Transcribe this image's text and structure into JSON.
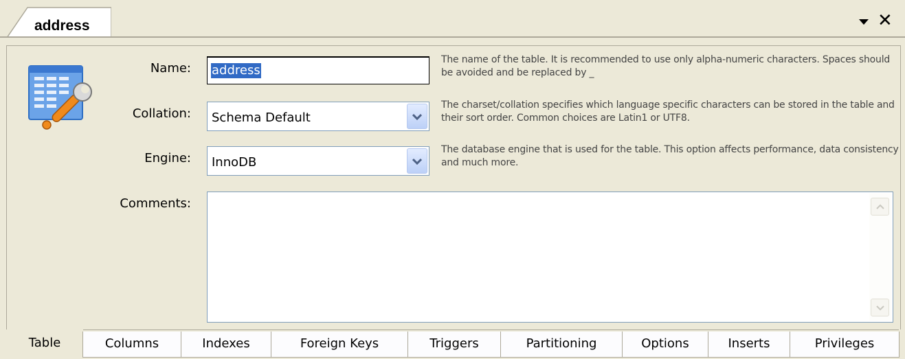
{
  "window": {
    "tab_title": "address",
    "menu_icon": "dropdown-arrow-icon",
    "close_icon": "close-x-icon"
  },
  "form": {
    "name_label": "Name:",
    "name_value": "address",
    "name_help": "The name of the table. It is recommended to use only alpha-numeric characters. Spaces should be avoided and be replaced by _",
    "collation_label": "Collation:",
    "collation_value": "Schema Default",
    "collation_help": "The charset/collation specifies which language specific characters can be stored in the table and their sort order. Common choices are Latin1 or UTF8.",
    "engine_label": "Engine:",
    "engine_value": "InnoDB",
    "engine_help": "The database engine that is used for the table. This option affects performance, data consistency and much more.",
    "comments_label": "Comments:",
    "comments_value": ""
  },
  "tabs": [
    {
      "label": "Table",
      "active": true
    },
    {
      "label": "Columns",
      "active": false
    },
    {
      "label": "Indexes",
      "active": false
    },
    {
      "label": "Foreign Keys",
      "active": false
    },
    {
      "label": "Triggers",
      "active": false
    },
    {
      "label": "Partitioning",
      "active": false
    },
    {
      "label": "Options",
      "active": false
    },
    {
      "label": "Inserts",
      "active": false
    },
    {
      "label": "Privileges",
      "active": false
    }
  ],
  "colors": {
    "panel_bg": "#ece9d8",
    "selection": "#316ac5",
    "input_border": "#7f9db9"
  }
}
